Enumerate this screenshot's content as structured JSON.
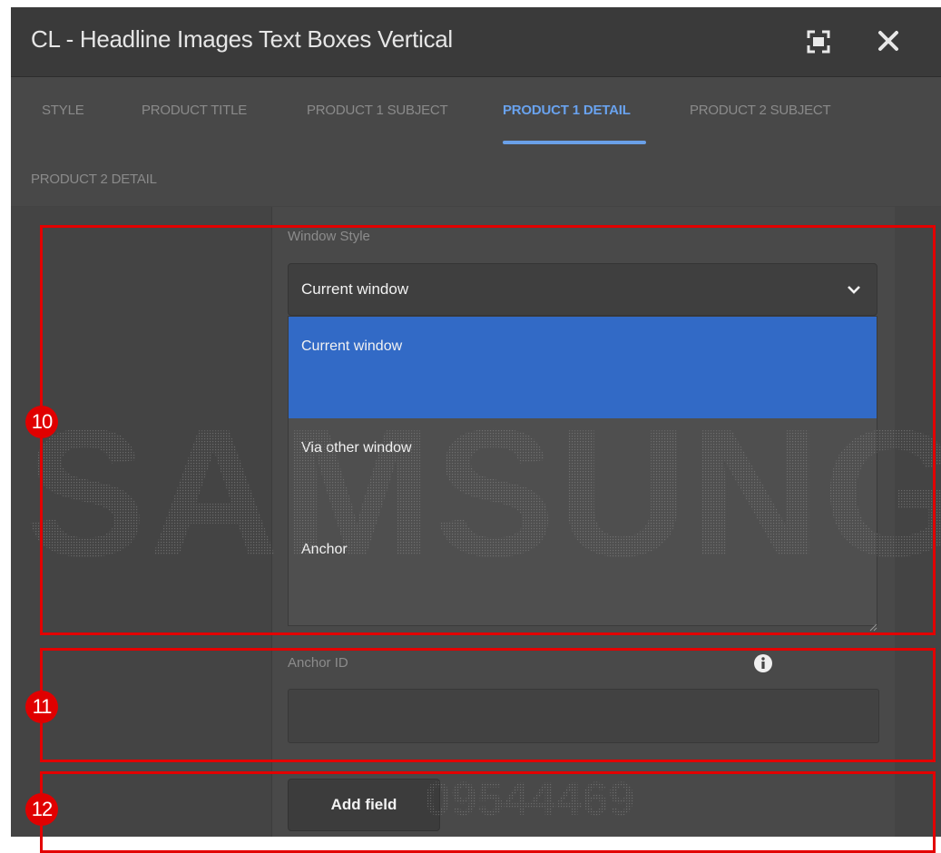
{
  "dialog": {
    "title": "CL - Headline Images Text Boxes Vertical",
    "fullscreen_icon": "fullscreen-icon",
    "close_icon": "close-icon"
  },
  "tabs": [
    {
      "label": "STYLE",
      "active": false
    },
    {
      "label": "PRODUCT TITLE",
      "active": false
    },
    {
      "label": "PRODUCT 1 SUBJECT",
      "active": false
    },
    {
      "label": "PRODUCT 1 DETAIL",
      "active": true
    },
    {
      "label": "PRODUCT 2 SUBJECT",
      "active": false
    },
    {
      "label": "PRODUCT 2 DETAIL",
      "active": false
    }
  ],
  "window_style": {
    "label": "Window Style",
    "selected": "Current window",
    "options": [
      "Current window",
      "Via other window",
      "Anchor"
    ]
  },
  "anchor_id": {
    "label": "Anchor ID",
    "value": "",
    "info_icon": "info-icon"
  },
  "add_field": {
    "label": "Add field"
  },
  "watermark": {
    "brand": "SAMSUNG",
    "code": "09544469"
  },
  "annotations": [
    "10",
    "11",
    "12"
  ],
  "colors": {
    "accent": "#6aa0e8",
    "selected_option": "#326ac6",
    "annotation": "#e30000"
  }
}
